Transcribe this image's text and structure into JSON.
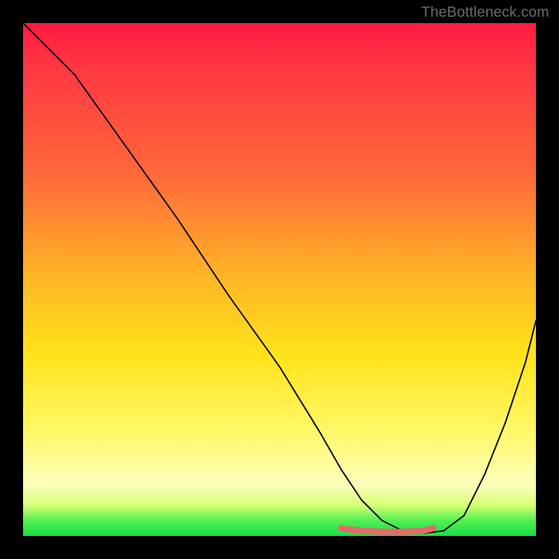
{
  "watermark": "TheBottleneck.com",
  "chart_data": {
    "type": "line",
    "title": "",
    "xlabel": "",
    "ylabel": "",
    "xlim": [
      0,
      100
    ],
    "ylim": [
      0,
      100
    ],
    "grid": false,
    "legend": false,
    "series": [
      {
        "name": "main-curve",
        "color": "#000000",
        "x": [
          0,
          5,
          10,
          20,
          30,
          40,
          50,
          58,
          62,
          66,
          70,
          74,
          78,
          82,
          86,
          90,
          94,
          98,
          100
        ],
        "y": [
          100,
          95,
          90,
          76,
          62,
          47,
          33,
          20,
          13,
          7,
          3,
          1,
          0.5,
          1,
          4,
          12,
          22,
          34,
          42
        ]
      },
      {
        "name": "bottom-marker",
        "color": "#e46a6a",
        "x": [
          62,
          66,
          70,
          74,
          78,
          80
        ],
        "y": [
          1.5,
          1.0,
          0.8,
          0.8,
          1.0,
          1.5
        ]
      }
    ],
    "background_gradient": {
      "stops": [
        {
          "pos": 0.0,
          "color": "#ff1a40"
        },
        {
          "pos": 0.08,
          "color": "#ff3543"
        },
        {
          "pos": 0.3,
          "color": "#ff6a3a"
        },
        {
          "pos": 0.5,
          "color": "#ffb726"
        },
        {
          "pos": 0.65,
          "color": "#ffe31b"
        },
        {
          "pos": 0.8,
          "color": "#fff86a"
        },
        {
          "pos": 0.9,
          "color": "#fcffbc"
        },
        {
          "pos": 0.94,
          "color": "#d7ff75"
        },
        {
          "pos": 0.97,
          "color": "#52f052"
        },
        {
          "pos": 1.0,
          "color": "#18df46"
        }
      ]
    }
  }
}
